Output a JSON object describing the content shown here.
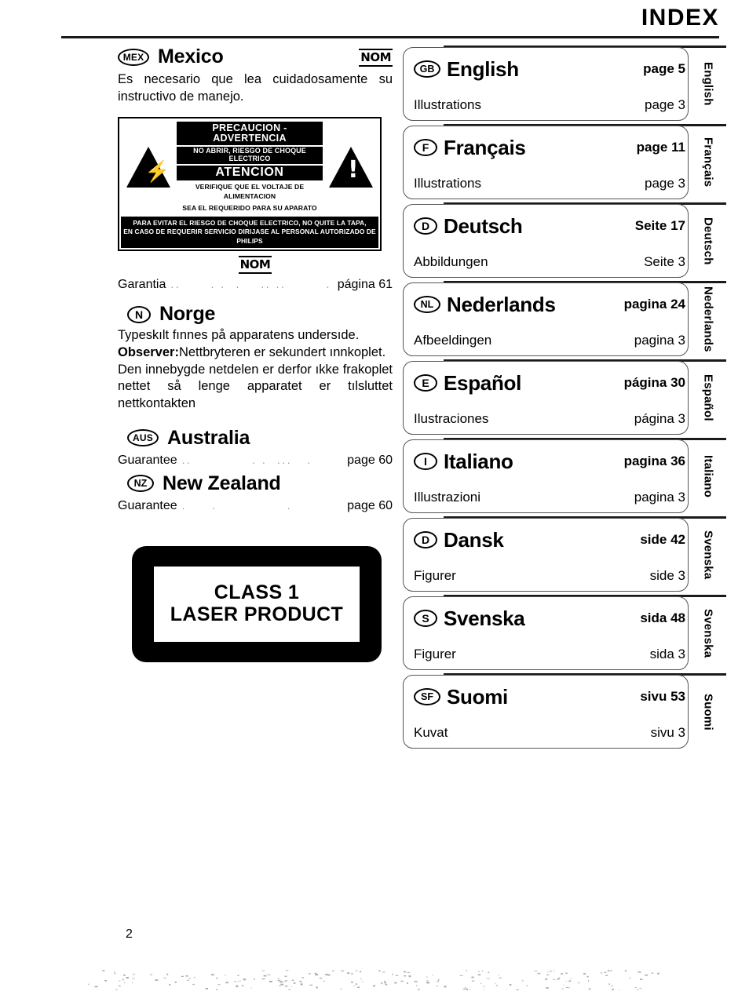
{
  "header": {
    "title": "INDEX"
  },
  "footer": {
    "page_number": "2"
  },
  "left_column": {
    "mexico": {
      "badge": "MEX",
      "name": "Mexico",
      "nom_mark": "NOM",
      "body": "Es necesario que lea cuidadosamente su instructivo de manejo.",
      "warning_label": {
        "band_precaucion": "PRECAUCION - ADVERTENCIA",
        "band_no_abrir": "NO ABRIR, RIESGO DE CHOQUE ELECTRICO",
        "band_atencion": "ATENCION",
        "plain_line1": "VERIFIQUE QUE EL VOLTAJE DE ALIMENTACION",
        "plain_line2": "SEA EL REQUERIDO PARA SU APARATO",
        "bottom_line1": "PARA EVITAR EL RIESGO DE CHOQUE ELECTRICO, NO QUITE LA TAPA,",
        "bottom_line2": "EN CASO DE REQUERIR SERVICIO DIRIJASE AL PERSONAL AUTORIZADO DE PHILIPS",
        "left_icon": "lightning-bolt-triangle-icon",
        "right_icon": "exclamation-triangle-icon"
      },
      "nom_mark_center": "NOM",
      "garantia_label": "Garantia",
      "garantia_page": "página 61"
    },
    "norge": {
      "badge": "N",
      "name": "Norge",
      "line1": "Typeskılt fınnes på apparatens undersıde.",
      "observer_label": "Observer:",
      "observer_text": "Nettbryteren er sekundert ınnkoplet.",
      "line3": "Den innebygde netdelen er derfor ıkke frakoplet nettet så lenge apparatet er tılsluttet nettkontakten"
    },
    "australia": {
      "badge": "AUS",
      "name": "Australia",
      "guarantee_label": "Guarantee",
      "guarantee_page": "page 60"
    },
    "new_zealand": {
      "badge": "NZ",
      "name": "New Zealand",
      "guarantee_label": "Guarantee",
      "guarantee_page": "page 60"
    },
    "laser_label": {
      "line1": "CLASS 1",
      "line2": "LASER PRODUCT"
    }
  },
  "languages": [
    {
      "badge": "GB",
      "name": "English",
      "page_main": "page 5",
      "sub_label": "Illustrations",
      "page_sub": "page 3",
      "tab": "English"
    },
    {
      "badge": "F",
      "name": "Français",
      "page_main": "page 11",
      "sub_label": "Illustrations",
      "page_sub": "page 3",
      "tab": "Français"
    },
    {
      "badge": "D",
      "name": "Deutsch",
      "page_main": "Seite 17",
      "sub_label": "Abbildungen",
      "page_sub": "Seite 3",
      "tab": "Deutsch"
    },
    {
      "badge": "NL",
      "name": "Nederlands",
      "page_main": "pagina 24",
      "sub_label": "Afbeeldingen",
      "page_sub": "pagina 3",
      "tab": "Nederlands"
    },
    {
      "badge": "E",
      "name": "Español",
      "page_main": "página 30",
      "sub_label": "Ilustraciones",
      "page_sub": "página 3",
      "tab": "Español"
    },
    {
      "badge": "I",
      "name": "Italiano",
      "page_main": "pagina 36",
      "sub_label": "Illustrazioni",
      "page_sub": "pagina 3",
      "tab": "Italiano"
    },
    {
      "badge": "D",
      "name": "Dansk",
      "page_main": "side 42",
      "sub_label": "Figurer",
      "page_sub": "side 3",
      "tab": "Svenska"
    },
    {
      "badge": "S",
      "name": "Svenska",
      "page_main": "sida 48",
      "sub_label": "Figurer",
      "page_sub": "sida 3",
      "tab": "Svenska"
    },
    {
      "badge": "SF",
      "name": "Suomi",
      "page_main": "sivu 53",
      "sub_label": "Kuvat",
      "page_sub": "sivu 3",
      "tab": "Suomi"
    }
  ]
}
